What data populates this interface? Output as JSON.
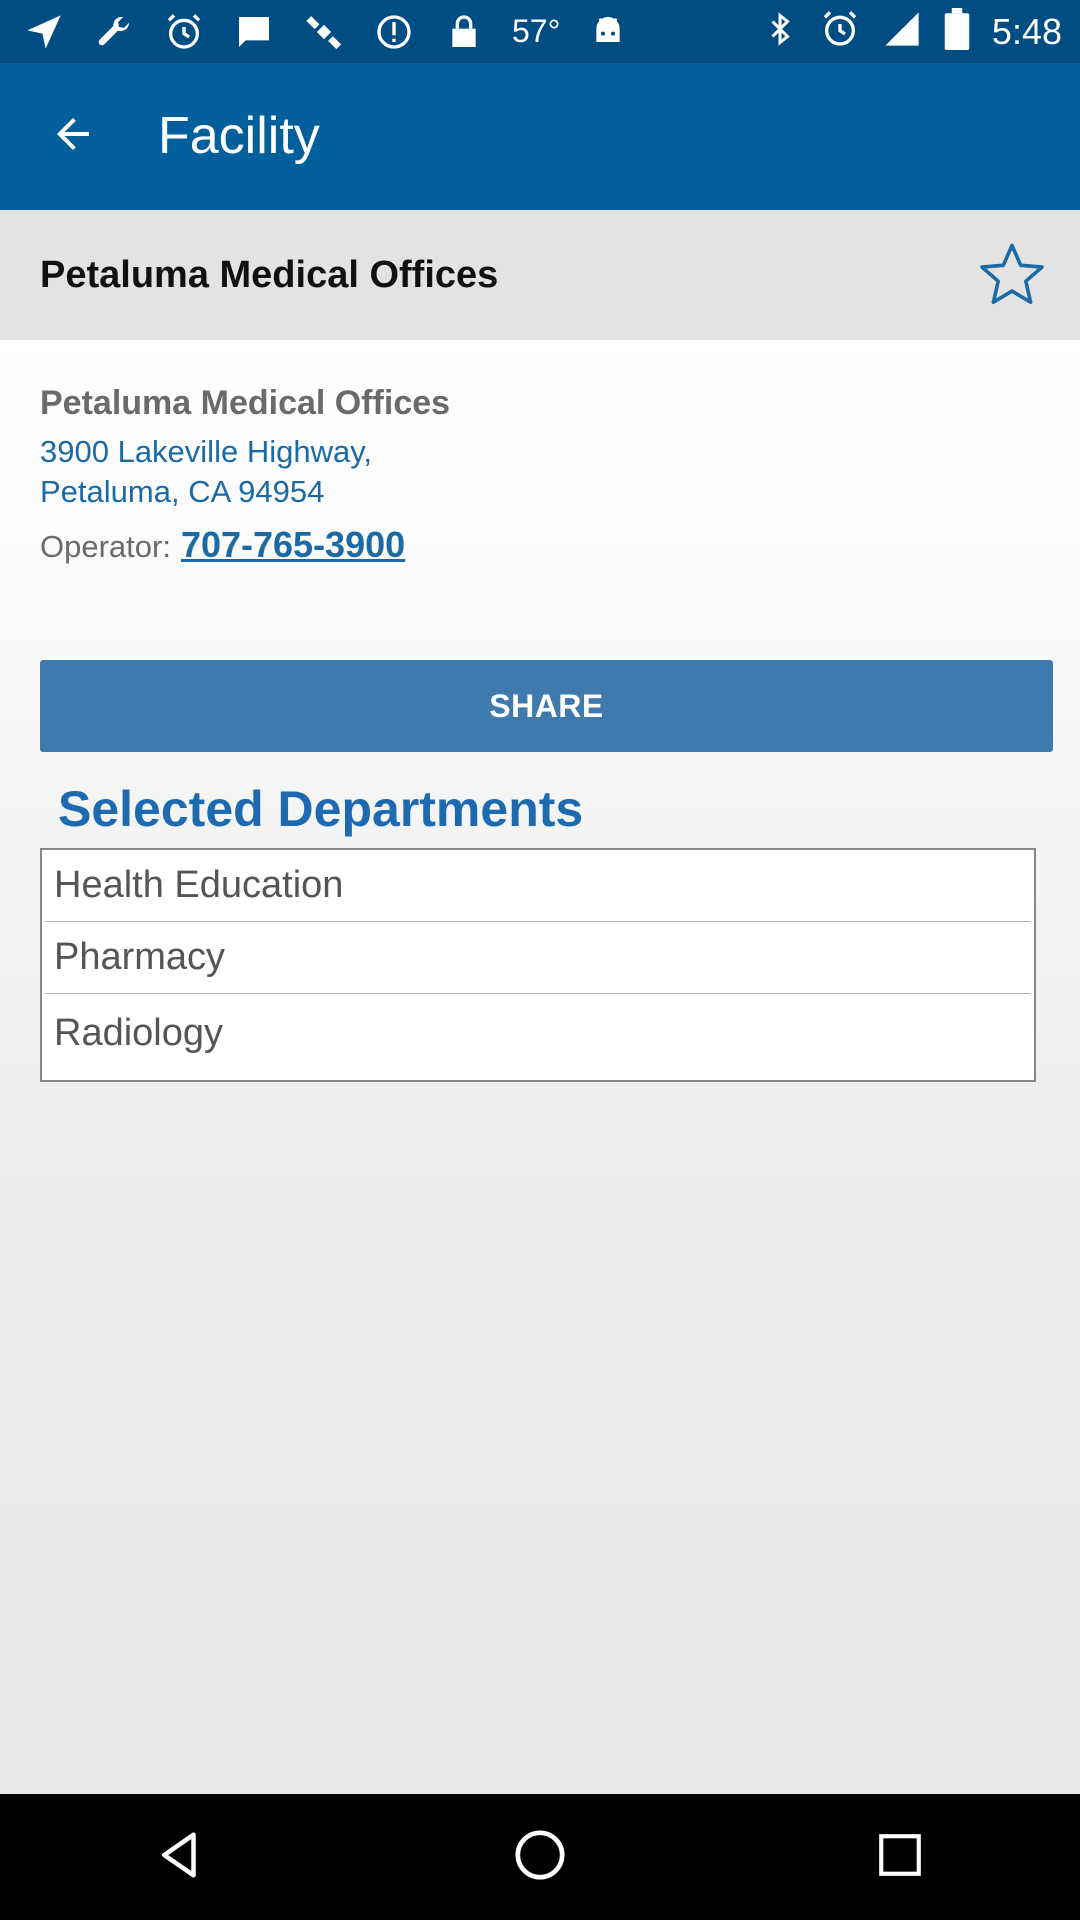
{
  "status_bar": {
    "temperature": "57°",
    "time": "5:48",
    "icons": [
      "navigation-icon",
      "wrench-icon",
      "alarm-icon",
      "message-icon",
      "satellite-icon",
      "info-icon",
      "lock-icon",
      "android-icon",
      "bluetooth-icon",
      "alarm-icon",
      "signal-icon",
      "battery-icon"
    ]
  },
  "app_bar": {
    "title": "Facility"
  },
  "facility": {
    "header_name": "Petaluma Medical Offices",
    "name": "Petaluma Medical Offices",
    "address_line1": "3900 Lakeville Highway,",
    "address_line2": "Petaluma, CA 94954",
    "operator_label": "Operator:",
    "operator_phone": "707-765-3900"
  },
  "share_label": "SHARE",
  "departments": {
    "title": "Selected Departments",
    "items": [
      "Health Education",
      "Pharmacy",
      "Radiology"
    ]
  },
  "colors": {
    "status_bar": "#004d83",
    "app_bar": "#01609b",
    "accent_link": "#1b6aa5",
    "share_button": "#3e7aad",
    "dept_title": "#1e6ab0"
  }
}
